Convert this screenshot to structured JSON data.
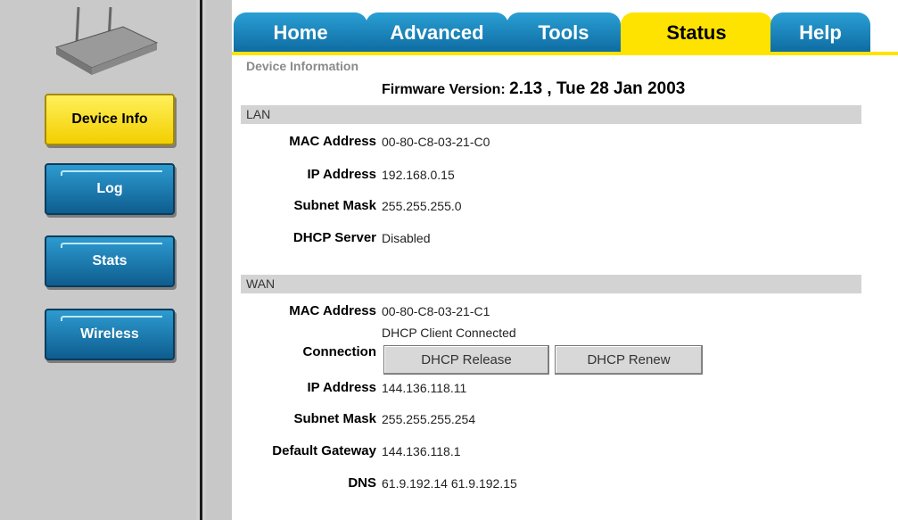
{
  "sidebar": {
    "buttons": [
      "Device Info",
      "Log",
      "Stats",
      "Wireless"
    ]
  },
  "tabs": [
    "Home",
    "Advanced",
    "Tools",
    "Status",
    "Help"
  ],
  "status": {
    "section_title": "Device Information",
    "firmware_label": "Firmware Version:",
    "firmware_value": "2.13 , Tue 28 Jan 2003"
  },
  "lan": {
    "header": "LAN",
    "mac_label": "MAC Address",
    "mac": "00-80-C8-03-21-C0",
    "ip_label": "IP Address",
    "ip": "192.168.0.15",
    "subnet_label": "Subnet Mask",
    "subnet": "255.255.255.0",
    "dhcp_label": "DHCP Server",
    "dhcp": "Disabled"
  },
  "wan": {
    "header": "WAN",
    "mac_label": "MAC Address",
    "mac": "00-80-C8-03-21-C1",
    "connection_label": "Connection",
    "connection": "DHCP Client Connected",
    "release_button": "DHCP Release",
    "renew_button": "DHCP Renew",
    "ip_label": "IP Address",
    "ip": "144.136.118.11",
    "subnet_label": "Subnet Mask",
    "subnet": "255.255.255.254",
    "gateway_label": "Default Gateway",
    "gateway": "144.136.118.1",
    "dns_label": "DNS",
    "dns": "61.9.192.14 61.9.192.15"
  },
  "colors": {
    "tab_blue": "#1a82bd",
    "active_yellow": "#ffe300",
    "section_gray": "#d3d3d3"
  }
}
